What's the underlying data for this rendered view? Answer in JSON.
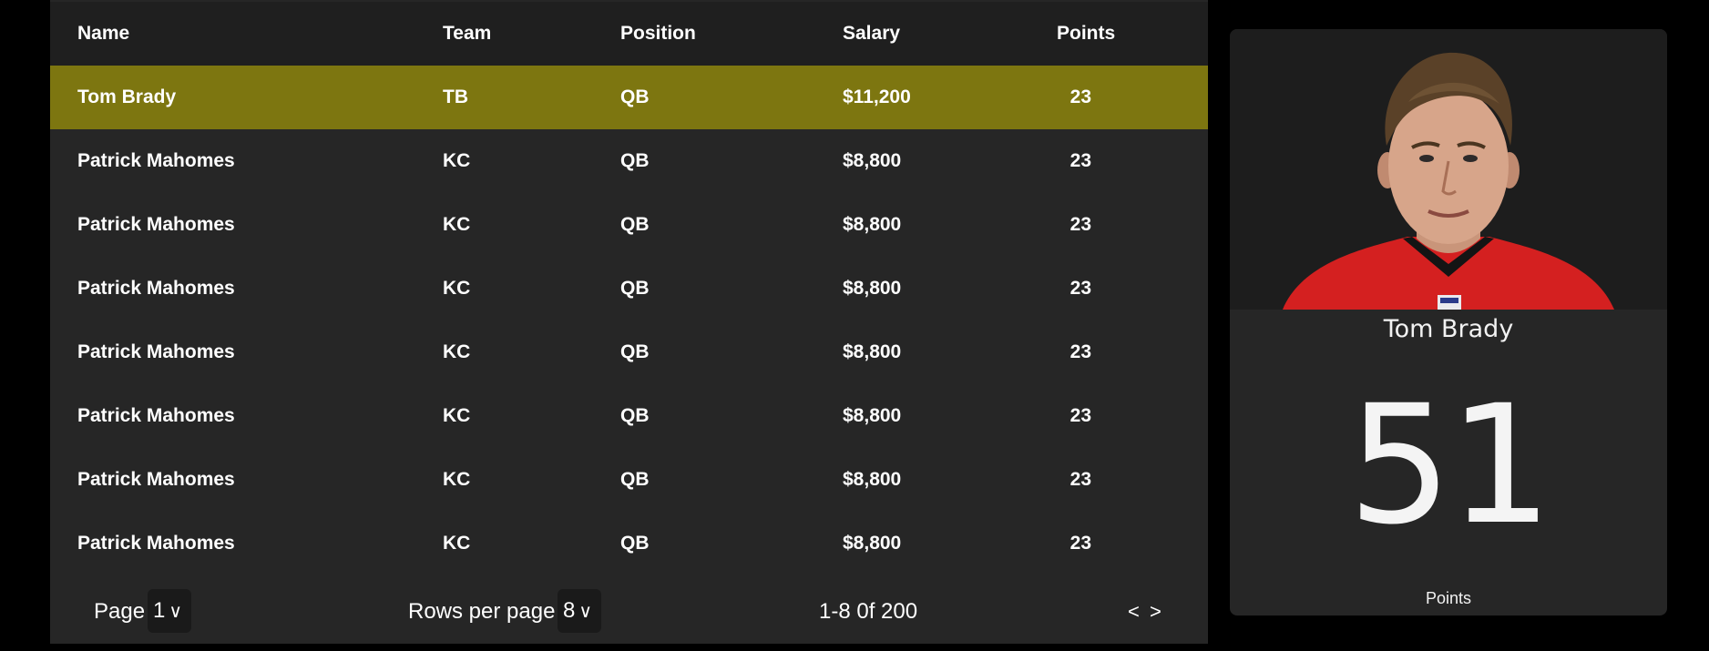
{
  "table": {
    "columns": [
      "Name",
      "Team",
      "Position",
      "Salary",
      "Points"
    ],
    "rows": [
      {
        "name": "Tom Brady",
        "team": "TB",
        "position": "QB",
        "salary": "$11,200",
        "points": "23",
        "selected": true
      },
      {
        "name": "Patrick Mahomes",
        "team": "KC",
        "position": "QB",
        "salary": "$8,800",
        "points": "23"
      },
      {
        "name": "Patrick Mahomes",
        "team": "KC",
        "position": "QB",
        "salary": "$8,800",
        "points": "23"
      },
      {
        "name": "Patrick Mahomes",
        "team": "KC",
        "position": "QB",
        "salary": "$8,800",
        "points": "23"
      },
      {
        "name": "Patrick Mahomes",
        "team": "KC",
        "position": "QB",
        "salary": "$8,800",
        "points": "23"
      },
      {
        "name": "Patrick Mahomes",
        "team": "KC",
        "position": "QB",
        "salary": "$8,800",
        "points": "23"
      },
      {
        "name": "Patrick Mahomes",
        "team": "KC",
        "position": "QB",
        "salary": "$8,800",
        "points": "23"
      },
      {
        "name": "Patrick Mahomes",
        "team": "KC",
        "position": "QB",
        "salary": "$8,800",
        "points": "23"
      }
    ]
  },
  "pagination": {
    "page_label": "Page",
    "page_value": "1",
    "rows_label": "Rows per page",
    "rows_value": "8",
    "chevron": "∨",
    "range_text": "1-8 0f 200",
    "prev": "<",
    "next": ">"
  },
  "detail": {
    "player_name": "Tom Brady",
    "points_value": "51",
    "points_label": "Points",
    "photo_icon": "player-headshot"
  },
  "colors": {
    "selected_row": "#7d7610",
    "panel_bg": "#262626",
    "jersey_red": "#d42020"
  }
}
